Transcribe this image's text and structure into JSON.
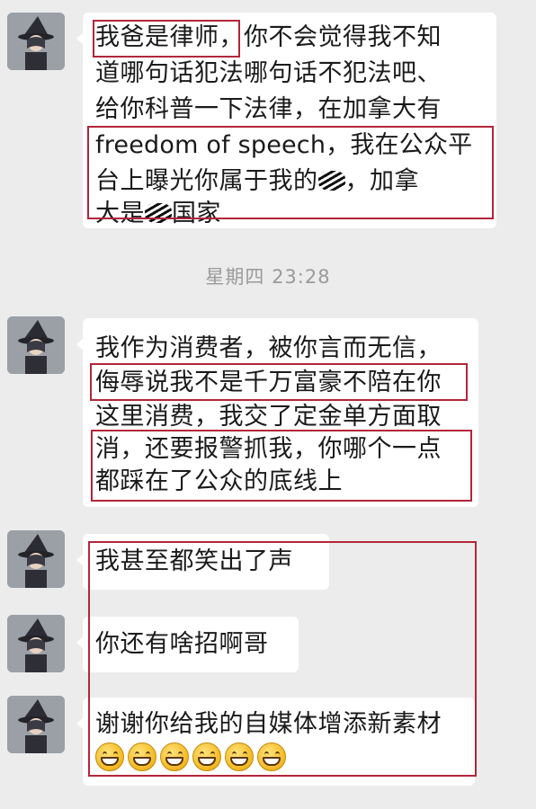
{
  "timestamp": "星期四 23:28",
  "messages": [
    {
      "lines": [
        "我爸是律师，你不会觉得我不知",
        "道哪句话犯法哪句话不犯法吧、",
        "给你科普一下法律，在加拿大有",
        "freedom of speech，我在公众平",
        "台上曝光你属于我的",
        "，加拿",
        "大是",
        "国家"
      ]
    },
    {
      "lines": [
        "我作为消费者，被你言而无信，",
        "侮辱说我不是千万富豪不陪在你",
        "这里消费，我交了定金单方面取",
        "消，还要报警抓我，你哪个一点",
        "都踩在了公众的底线上"
      ]
    },
    {
      "text": "我甚至都笑出了声"
    },
    {
      "text": "你还有啥招啊哥"
    },
    {
      "text": "谢谢你给我的自媒体增添新素材",
      "emoji_name": "grinning-face-emoji",
      "emoji_count": 6
    }
  ],
  "colors": {
    "highlight_box": "#b3263a",
    "bubble": "#ffffff",
    "background": "#ececec"
  }
}
